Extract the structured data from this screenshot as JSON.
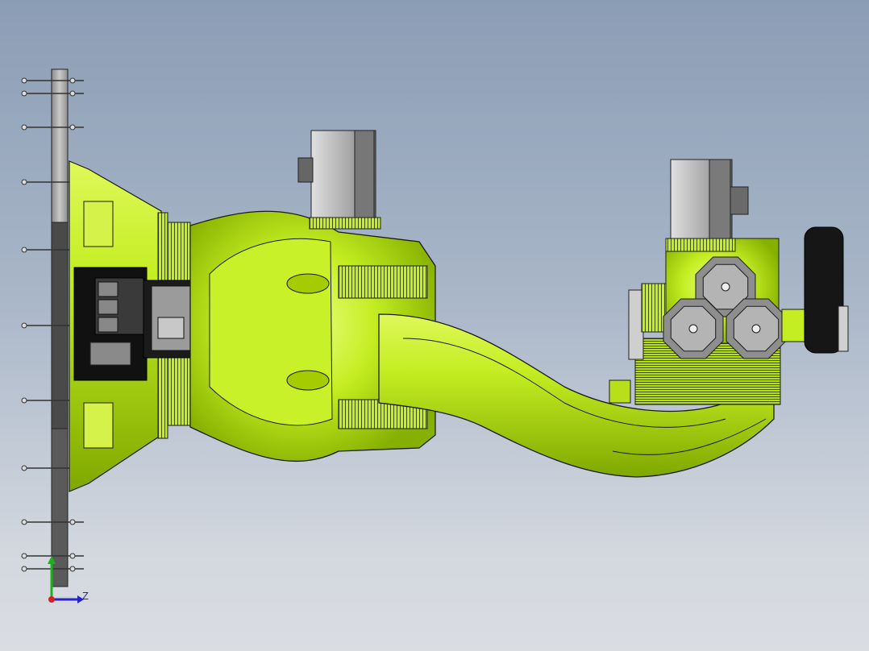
{
  "viewport": {
    "background_top": "#8b9db5",
    "background_bottom": "#dadde2"
  },
  "model": {
    "body_color": "#c2ee1f",
    "body_highlight": "#e6ff74",
    "body_shadow": "#86b000",
    "metal_color": "#b5b5b5",
    "motor_color": "#a8a8a8",
    "edge_color": "#1b1b1b"
  },
  "triad": {
    "x_color": "#d42222",
    "y_color": "#1db11d",
    "z_color": "#2424c8",
    "z_label": "Z",
    "icon": "axis-triad-icon"
  }
}
